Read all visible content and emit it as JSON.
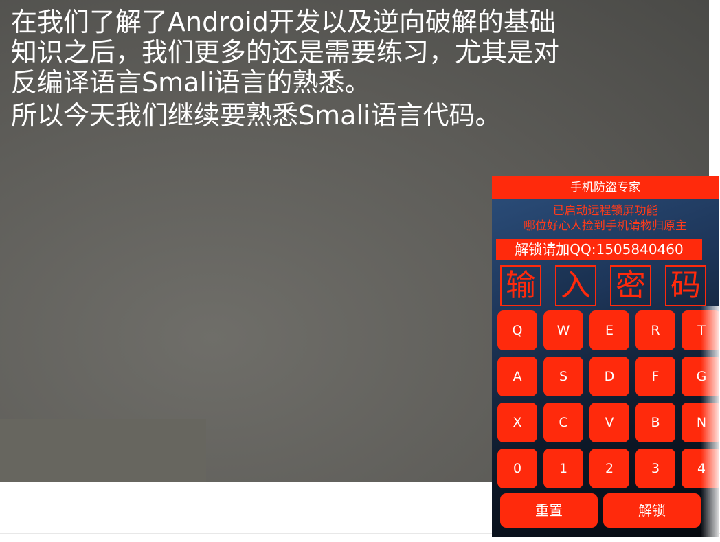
{
  "slide": {
    "lines": [
      "在我们了解了Android开发以及逆向破解的基础",
      "知识之后，我们更多的还是需要练习，尤其是对",
      "反编译语言Smali语言的熟悉。",
      "所以今天我们继续要熟悉Smali语言代码。"
    ]
  },
  "phone": {
    "title": "手机防盗专家",
    "warning": [
      "已启动远程锁屏功能",
      "哪位好心人捡到手机请物归原主"
    ],
    "qq": "解锁请加QQ:1505840460",
    "password_chars": [
      "输",
      "入",
      "密",
      "码"
    ],
    "keys": [
      [
        "Q",
        "W",
        "E",
        "R",
        "T"
      ],
      [
        "A",
        "S",
        "D",
        "F",
        "G"
      ],
      [
        "X",
        "C",
        "V",
        "B",
        "N"
      ],
      [
        "0",
        "1",
        "2",
        "3",
        "4"
      ]
    ],
    "reset_label": "重置",
    "unlock_label": "解锁"
  },
  "colors": {
    "accent": "#ff2a0c",
    "slide_bg": "#5c5b57"
  }
}
